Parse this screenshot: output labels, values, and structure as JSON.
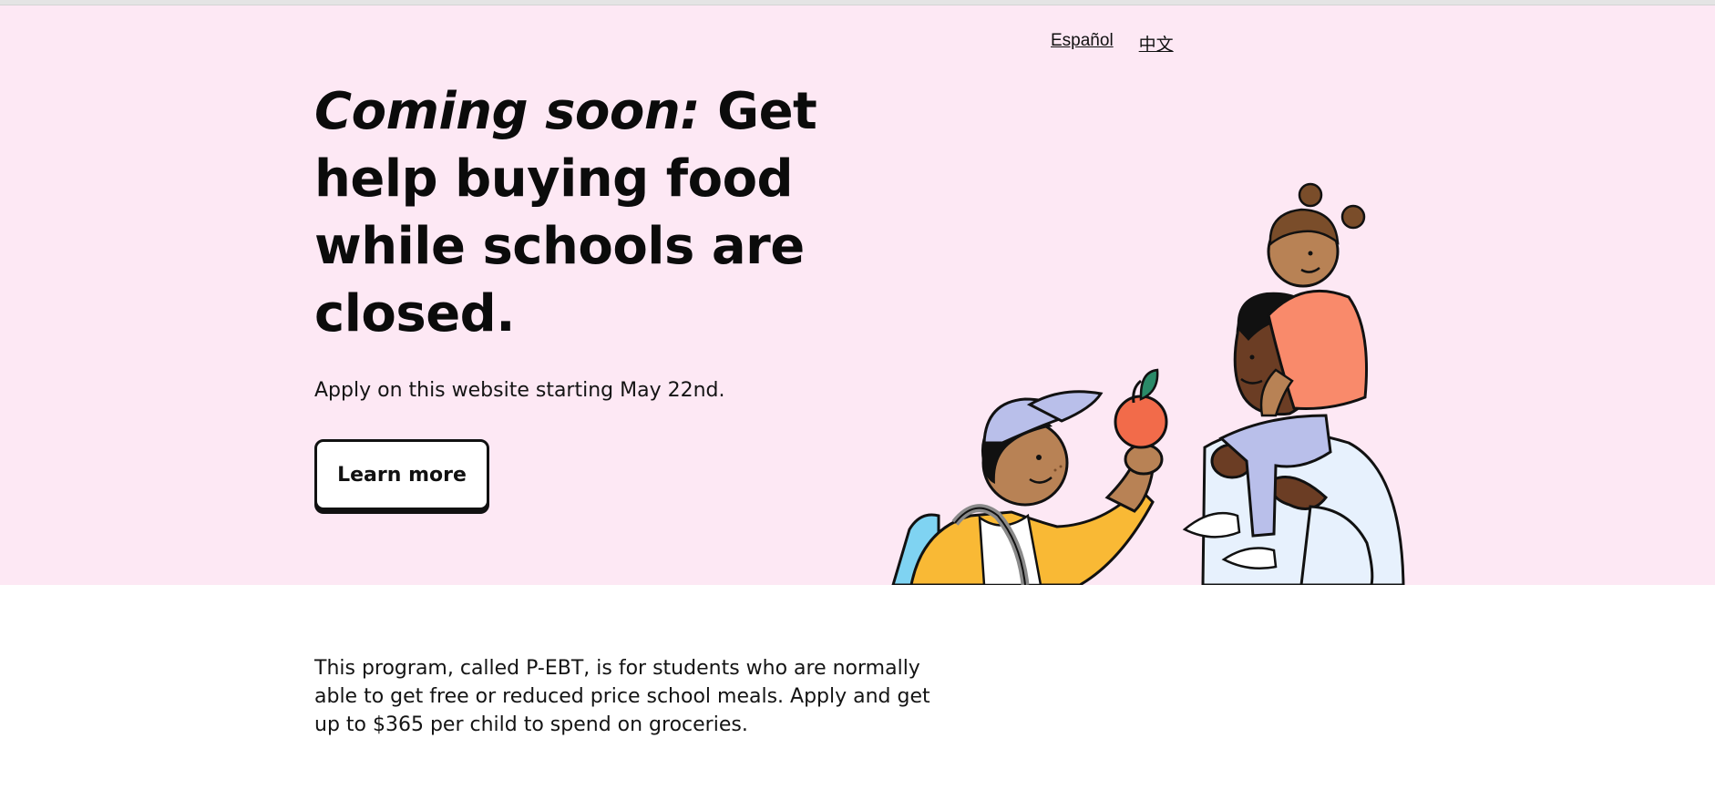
{
  "header": {
    "languages": [
      {
        "label": "Español"
      },
      {
        "label": "中文"
      }
    ]
  },
  "hero": {
    "headline_italic": "Coming soon:",
    "headline_rest": " Get help buying food while schools are closed.",
    "subline": "Apply on this website starting May 22nd.",
    "button_label": "Learn more",
    "background_color": "#fde8f4"
  },
  "illustration": {
    "icon": "family-with-apple-illustration"
  },
  "main": {
    "program_text": "This program, called P-EBT, is for students who are normally able to get free or reduced price school meals. Apply and get up to $365 per child to spend on groceries."
  }
}
